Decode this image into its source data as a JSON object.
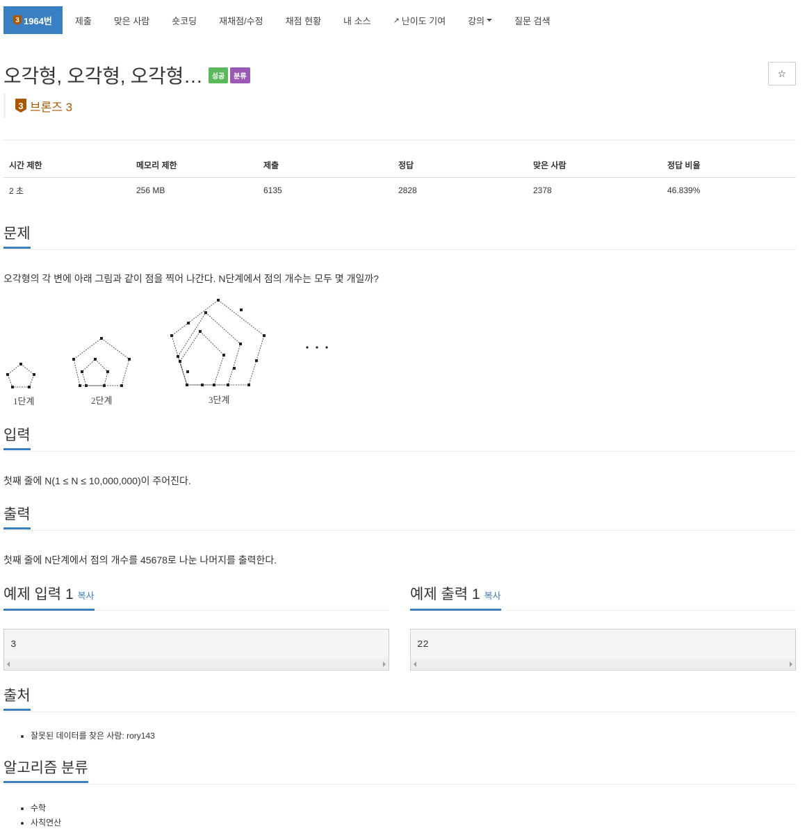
{
  "nav": {
    "problem_tier": "3",
    "problem_number": "1964번",
    "items": [
      "제출",
      "맞은 사람",
      "숏코딩",
      "재채점/수정",
      "채점 현황",
      "내 소스",
      "난이도 기여",
      "강의",
      "질문 검색"
    ]
  },
  "problem": {
    "title": "오각형, 오각형, 오각형…",
    "label_success": "성공",
    "label_class": "분류",
    "star": "☆",
    "tier_number": "3",
    "tier_text": "브론즈 3"
  },
  "info": {
    "headers": [
      "시간 제한",
      "메모리 제한",
      "제출",
      "정답",
      "맞은 사람",
      "정답 비율"
    ],
    "values": [
      "2 초",
      "256 MB",
      "6135",
      "2828",
      "2378",
      "46.839%"
    ]
  },
  "sections": {
    "problem_title": "문제",
    "problem_text": "오각형의 각 변에 아래 그림과 같이 점을 찍어 나간다. N단계에서 점의 개수는 모두 몇 개일까?",
    "figure_labels": [
      "1단계",
      "2단계",
      "3단계"
    ],
    "input_title": "입력",
    "input_text": "첫째 줄에 N(1 ≤ N ≤ 10,000,000)이 주어진다.",
    "output_title": "출력",
    "output_text": "첫째 줄에 N단계에서 점의 개수를 45678로 나눈 나머지를 출력한다.",
    "sample_input_title": "예제 입력 1",
    "sample_output_title": "예제 출력 1",
    "copy": "복사",
    "sample_input": "3",
    "sample_output": "22",
    "source_title": "출처",
    "source_prefix": "잘못된 데이터를 찾은 사람: ",
    "source_user": "rory143",
    "algo_title": "알고리즘 분류",
    "algos": [
      "수학",
      "사칙연산"
    ]
  },
  "colors": {
    "accent": "#3a7ec3",
    "bronze": "#ad5600",
    "success": "#5cb85c",
    "class": "#9b59b6"
  }
}
